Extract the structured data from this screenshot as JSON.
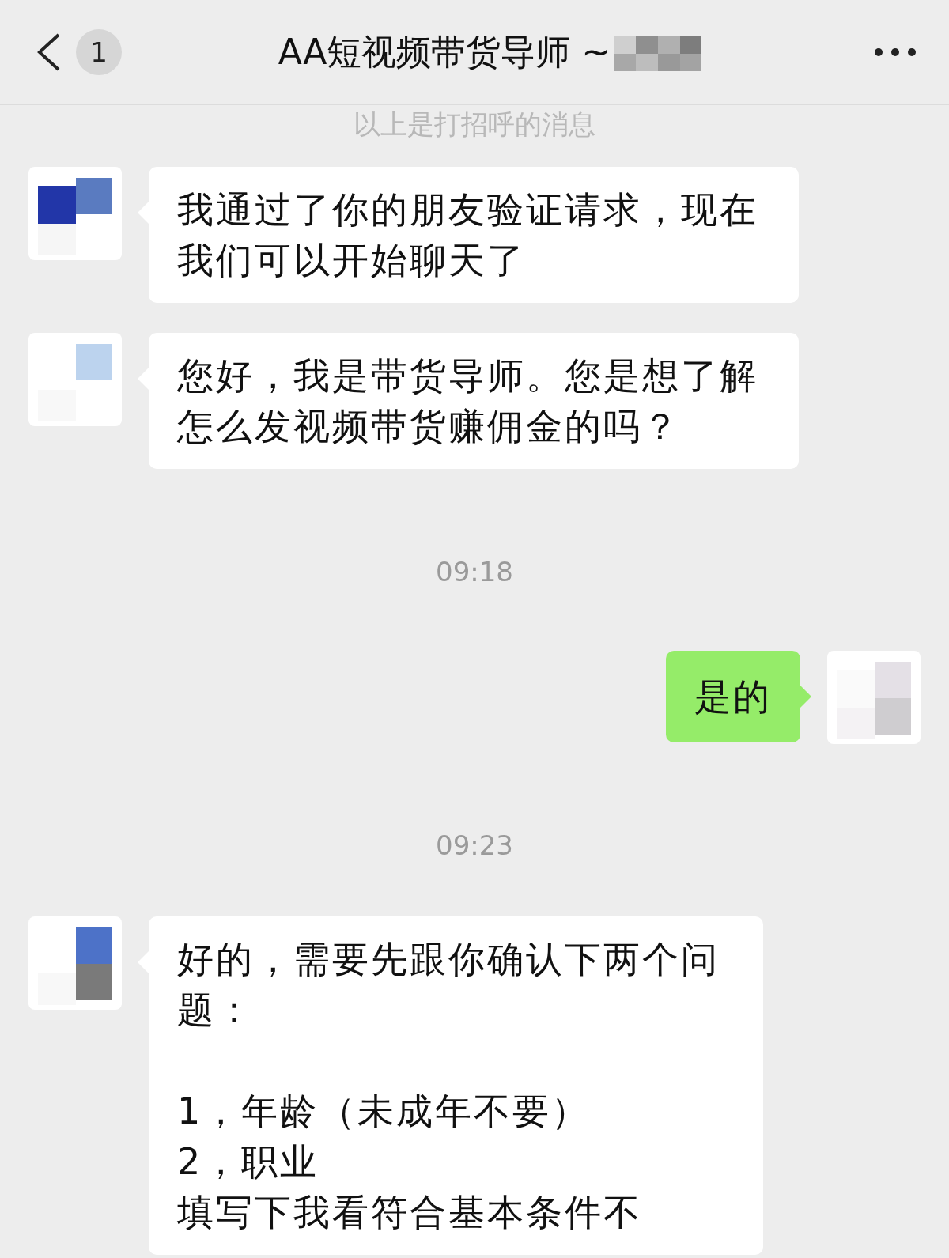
{
  "header": {
    "back_badge": "1",
    "title": "AA短视频带货导师 ~"
  },
  "messages": [
    {
      "kind": "system",
      "text": "以上是打招呼的消息"
    },
    {
      "kind": "received",
      "paragraphs": [
        [
          "我通过了你的朋友验证请求，现在我们可以开始聊天了"
        ]
      ]
    },
    {
      "kind": "received",
      "paragraphs": [
        [
          "您好，我是带货导师。您是想了解怎么发视频带货赚佣金的吗？"
        ]
      ]
    },
    {
      "kind": "time",
      "text": "09:18"
    },
    {
      "kind": "sent",
      "paragraphs": [
        [
          "是的"
        ]
      ]
    },
    {
      "kind": "time",
      "text": "09:23"
    },
    {
      "kind": "received",
      "paragraphs": [
        [
          "好的，需要先跟你确认下两个问题："
        ],
        [
          "1，年龄（未成年不要）",
          "2，职业",
          "填写下我看符合基本条件不"
        ]
      ]
    }
  ]
}
